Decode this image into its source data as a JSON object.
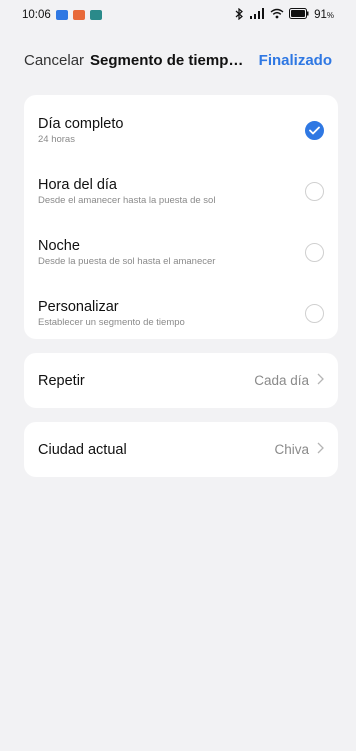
{
  "status_bar": {
    "time": "10:06",
    "battery": "91",
    "battery_suffix": "%"
  },
  "nav": {
    "cancel_label": "Cancelar",
    "title": "Segmento de tiempo de…",
    "done_label": "Finalizado"
  },
  "options": [
    {
      "title": "Día completo",
      "subtitle": "24 horas",
      "selected": true
    },
    {
      "title": "Hora del día",
      "subtitle": "Desde el amanecer hasta la puesta de sol",
      "selected": false
    },
    {
      "title": "Noche",
      "subtitle": "Desde la puesta de sol hasta el amanecer",
      "selected": false
    },
    {
      "title": "Personalizar",
      "subtitle": "Establecer un segmento de tiempo",
      "selected": false
    }
  ],
  "repeat": {
    "label": "Repetir",
    "value": "Cada día"
  },
  "city": {
    "label": "Ciudad actual",
    "value": "Chiva"
  },
  "colors": {
    "accent": "#2f78e3",
    "background": "#f2f2f4",
    "card": "#ffffff"
  }
}
